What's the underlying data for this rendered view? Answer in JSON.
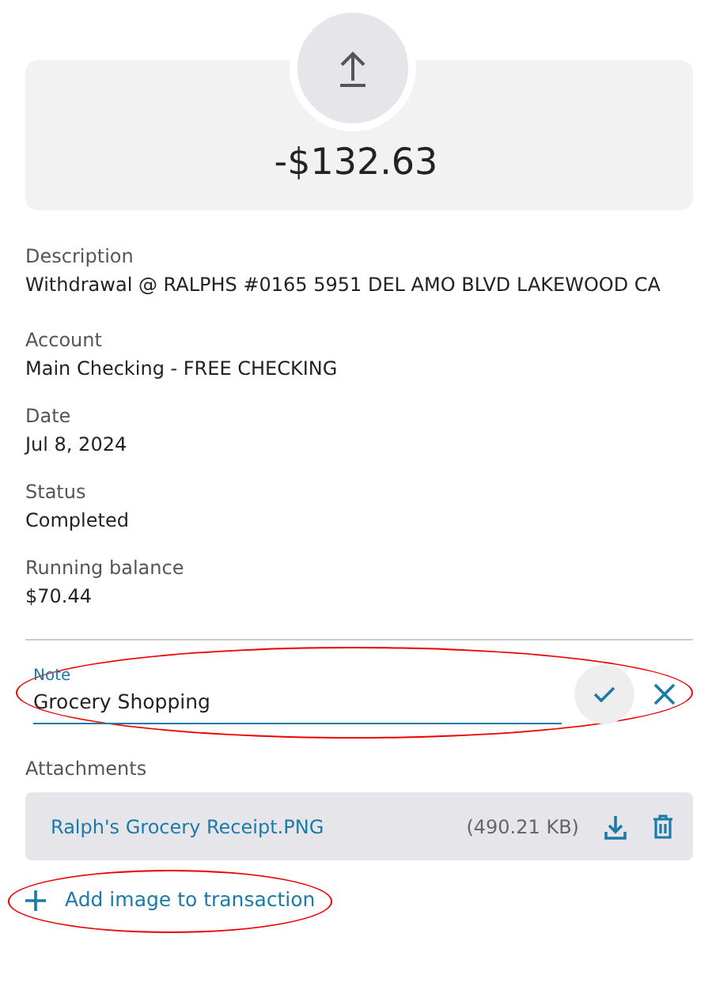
{
  "amount": "-$132.63",
  "details": [
    {
      "label": "Description",
      "value": "Withdrawal @ RALPHS #0165 5951 DEL AMO BLVD LAKEWOOD CA"
    },
    {
      "label": "Account",
      "value": "Main Checking - FREE CHECKING"
    },
    {
      "label": "Date",
      "value": "Jul 8, 2024"
    },
    {
      "label": "Status",
      "value": "Completed"
    },
    {
      "label": "Running balance",
      "value": "$70.44"
    }
  ],
  "note": {
    "label": "Note",
    "value": "Grocery Shopping",
    "circled": true
  },
  "attachments_label": "Attachments",
  "attachments": [
    {
      "name": "Ralph's Grocery Receipt.PNG",
      "size": "(490.21 KB)"
    }
  ],
  "add_image": {
    "label": "Add image to transaction",
    "circled": true
  }
}
